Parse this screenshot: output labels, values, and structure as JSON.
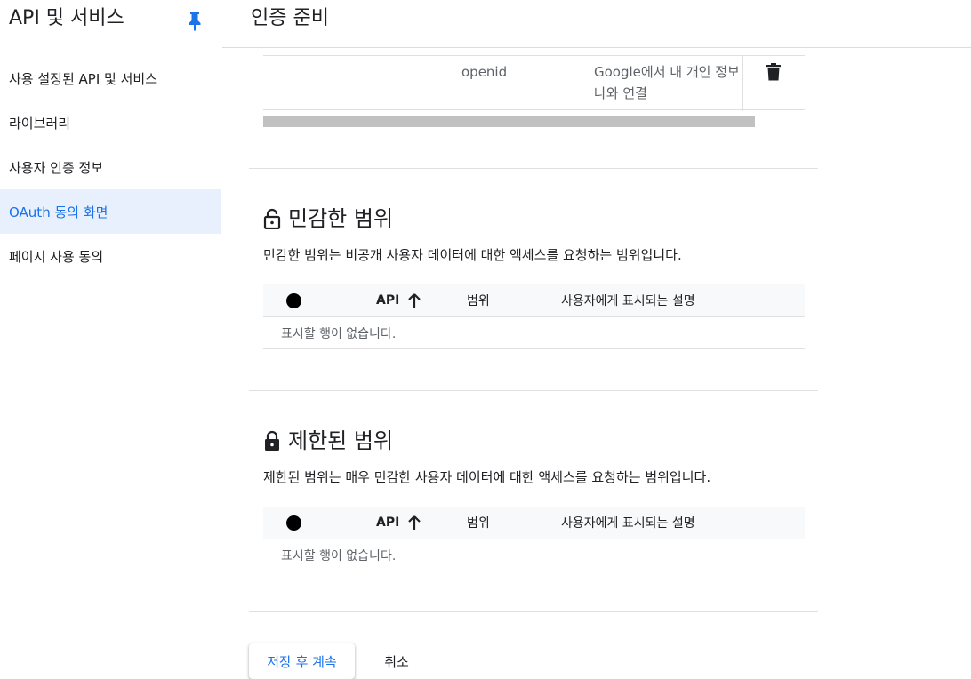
{
  "sidebar": {
    "title": "API 및 서비스",
    "items": [
      {
        "label": "사용 설정된 API 및 서비스"
      },
      {
        "label": "라이브러리"
      },
      {
        "label": "사용자 인증 정보"
      },
      {
        "label": "OAuth 동의 화면"
      },
      {
        "label": "페이지 사용 동의"
      }
    ],
    "active_index": 3
  },
  "header": {
    "title": "인증 준비"
  },
  "scope_row": {
    "scope": "openid",
    "description_line1": "Google에서 내 개인 정보",
    "description_line2": "나와 연결"
  },
  "sensitive": {
    "title": "민감한 범위",
    "description": "민감한 범위는 비공개 사용자 데이터에 대한 액세스를 요청하는 범위입니다.",
    "columns": {
      "api": "API",
      "scope": "범위",
      "desc": "사용자에게 표시되는 설명"
    },
    "empty": "표시할 행이 없습니다."
  },
  "restricted": {
    "title": "제한된 범위",
    "description": "제한된 범위는 매우 민감한 사용자 데이터에 대한 액세스를 요청하는 범위입니다.",
    "columns": {
      "api": "API",
      "scope": "범위",
      "desc": "사용자에게 표시되는 설명"
    },
    "empty": "표시할 행이 없습니다."
  },
  "actions": {
    "save_label": "저장 후 계속",
    "cancel_label": "취소"
  },
  "colors": {
    "accent": "#1a73e8",
    "active_bg": "#e8f0fe",
    "pin": "#1a73e8"
  },
  "icons": {
    "pin": "pin-icon",
    "trash": "trash-icon",
    "unlock": "lock-open-icon",
    "lock": "lock-icon",
    "sort": "arrow-up-icon"
  }
}
